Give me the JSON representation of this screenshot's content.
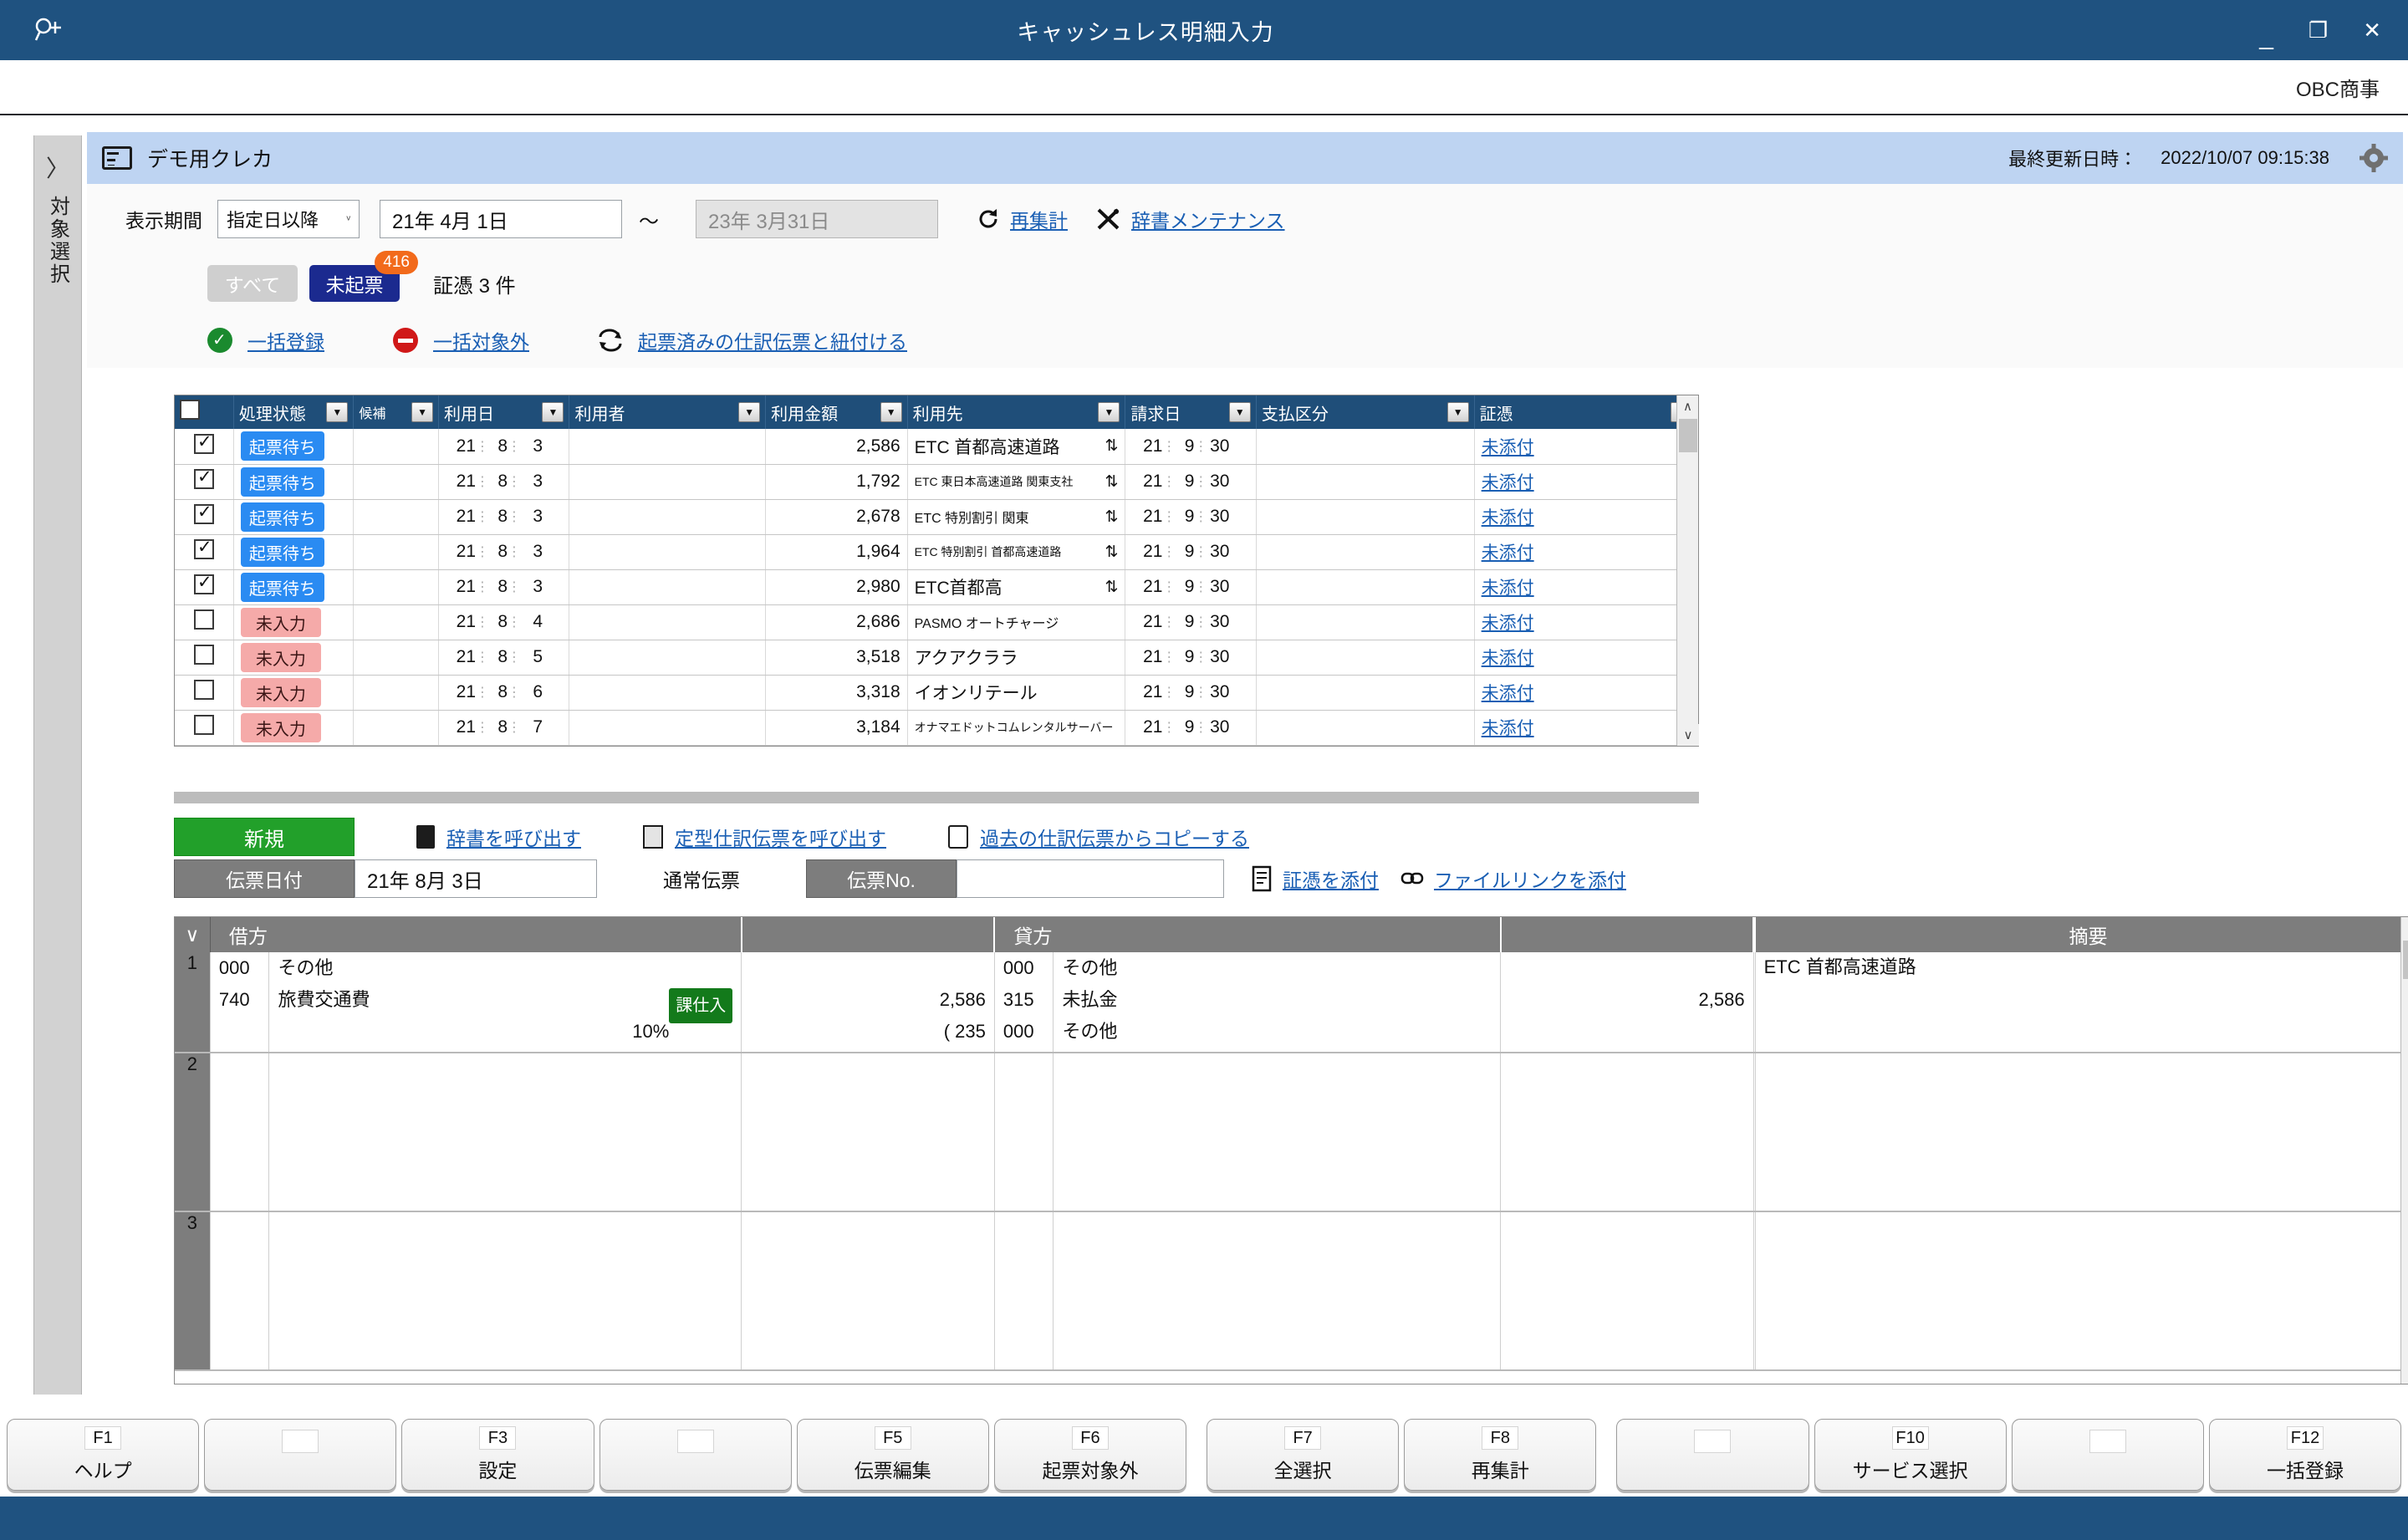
{
  "titlebar": {
    "title": "キャッシュレス明細入力",
    "search_icon": "search-plus-icon",
    "minimize": "_",
    "restore": "❐",
    "close": "✕"
  },
  "company": {
    "name": "OBC商事"
  },
  "leftrail": {
    "chevron": "〉",
    "label": "対象選択"
  },
  "cardhead": {
    "title": "デモ用クレカ",
    "lastupdate_label": "最終更新日時：",
    "lastupdate_value": "2022/10/07 09:15:38"
  },
  "filters": {
    "period_label": "表示期間",
    "period_mode": "指定日以降",
    "date_from": "21年  4月  1日",
    "tilde": "～",
    "date_to": "23年  3月31日",
    "recalc_link": "再集計",
    "dictionary_link": "辞書メンテナンス"
  },
  "tabs": {
    "all_label": "すべて",
    "unposted_label": "未起票",
    "unposted_badge": "416",
    "evidence_count": "証憑 3 件"
  },
  "actions": {
    "bulk_register": "一括登録",
    "bulk_exclude": "一括対象外",
    "link_existing": "起票済みの仕訳伝票と紐付ける"
  },
  "table": {
    "columns": [
      "",
      "処理状態",
      "候補",
      "利用日",
      "利用者",
      "利用金額",
      "利用先",
      "請求日",
      "支払区分",
      "証憑"
    ],
    "rows": [
      {
        "checked": true,
        "selected": true,
        "status": "起票待ち",
        "status_kind": "wait",
        "candidate": "",
        "use_y": "21",
        "use_m": "8",
        "use_d": "3",
        "user": "",
        "amount": "2,586",
        "vendor": "ETC 首都高速道路",
        "vendor_size": "normal",
        "swap": true,
        "bill_y": "21",
        "bill_m": "9",
        "bill_d": "30",
        "pay_type": "",
        "evidence": "未添付"
      },
      {
        "checked": true,
        "selected": false,
        "status": "起票待ち",
        "status_kind": "wait",
        "candidate": "",
        "use_y": "21",
        "use_m": "8",
        "use_d": "3",
        "user": "",
        "amount": "1,792",
        "vendor": "ETC 東日本高速道路 関東支社",
        "vendor_size": "xsmall",
        "swap": true,
        "bill_y": "21",
        "bill_m": "9",
        "bill_d": "30",
        "pay_type": "",
        "evidence": "未添付"
      },
      {
        "checked": true,
        "selected": false,
        "status": "起票待ち",
        "status_kind": "wait",
        "candidate": "",
        "use_y": "21",
        "use_m": "8",
        "use_d": "3",
        "user": "",
        "amount": "2,678",
        "vendor": "ETC 特別割引 関東",
        "vendor_size": "small",
        "swap": true,
        "bill_y": "21",
        "bill_m": "9",
        "bill_d": "30",
        "pay_type": "",
        "evidence": "未添付"
      },
      {
        "checked": true,
        "selected": false,
        "status": "起票待ち",
        "status_kind": "wait",
        "candidate": "",
        "use_y": "21",
        "use_m": "8",
        "use_d": "3",
        "user": "",
        "amount": "1,964",
        "vendor": "ETC 特別割引 首都高速道路",
        "vendor_size": "xsmall",
        "swap": true,
        "bill_y": "21",
        "bill_m": "9",
        "bill_d": "30",
        "pay_type": "",
        "evidence": "未添付"
      },
      {
        "checked": true,
        "selected": false,
        "status": "起票待ち",
        "status_kind": "wait",
        "candidate": "",
        "use_y": "21",
        "use_m": "8",
        "use_d": "3",
        "user": "",
        "amount": "2,980",
        "vendor": "ETC首都高",
        "vendor_size": "normal",
        "swap": true,
        "bill_y": "21",
        "bill_m": "9",
        "bill_d": "30",
        "pay_type": "",
        "evidence": "未添付"
      },
      {
        "checked": false,
        "selected": false,
        "status": "未入力",
        "status_kind": "unentered",
        "candidate": "",
        "use_y": "21",
        "use_m": "8",
        "use_d": "4",
        "user": "",
        "amount": "2,686",
        "vendor": "PASMO オートチャージ",
        "vendor_size": "small",
        "swap": false,
        "bill_y": "21",
        "bill_m": "9",
        "bill_d": "30",
        "pay_type": "",
        "evidence": "未添付"
      },
      {
        "checked": false,
        "selected": false,
        "status": "未入力",
        "status_kind": "unentered",
        "candidate": "",
        "use_y": "21",
        "use_m": "8",
        "use_d": "5",
        "user": "",
        "amount": "3,518",
        "vendor": "アクアクララ",
        "vendor_size": "normal",
        "swap": false,
        "bill_y": "21",
        "bill_m": "9",
        "bill_d": "30",
        "pay_type": "",
        "evidence": "未添付"
      },
      {
        "checked": false,
        "selected": false,
        "status": "未入力",
        "status_kind": "unentered",
        "candidate": "",
        "use_y": "21",
        "use_m": "8",
        "use_d": "6",
        "user": "",
        "amount": "3,318",
        "vendor": "イオンリテール",
        "vendor_size": "normal",
        "swap": false,
        "bill_y": "21",
        "bill_m": "9",
        "bill_d": "30",
        "pay_type": "",
        "evidence": "未添付"
      },
      {
        "checked": false,
        "selected": false,
        "status": "未入力",
        "status_kind": "unentered",
        "candidate": "",
        "use_y": "21",
        "use_m": "8",
        "use_d": "7",
        "user": "",
        "amount": "3,184",
        "vendor": "オナマエドットコムレンタルサーバー",
        "vendor_size": "xsmall",
        "swap": false,
        "bill_y": "21",
        "bill_m": "9",
        "bill_d": "30",
        "pay_type": "",
        "evidence": "未添付"
      }
    ]
  },
  "voucher": {
    "new_button": "新規",
    "dictionary_call": "辞書を呼び出す",
    "template_call": "定型仕訳伝票を呼び出す",
    "copy_past": "過去の仕訳伝票からコピーする",
    "date_label": "伝票日付",
    "date_value": "21年  8月  3日",
    "voucher_type": "通常伝票",
    "no_label": "伝票No.",
    "no_value": "",
    "attach_evidence": "証憑を添付",
    "attach_filelink": "ファイルリンクを添付"
  },
  "journal": {
    "headers": {
      "debit": "借方",
      "credit": "貸方",
      "summary": "摘要"
    },
    "rows": [
      {
        "no": "1",
        "debit": [
          {
            "code": "000",
            "name": "その他",
            "tax": "",
            "rate": "",
            "amount": ""
          },
          {
            "code": "740",
            "name": "旅費交通費",
            "tax": "課仕入",
            "rate": "",
            "amount": "2,586"
          },
          {
            "code": "",
            "name": "",
            "tax": "",
            "rate": "10%",
            "amount": "( 235"
          }
        ],
        "credit": [
          {
            "code": "000",
            "name": "その他",
            "amount": ""
          },
          {
            "code": "315",
            "name": "未払金",
            "amount": "2,586"
          },
          {
            "code": "000",
            "name": "その他",
            "amount": ""
          }
        ],
        "summary": "ETC 首都高速道路"
      },
      {
        "no": "2",
        "debit": [],
        "credit": [],
        "summary": ""
      },
      {
        "no": "3",
        "debit": [],
        "credit": [],
        "summary": ""
      }
    ]
  },
  "fkeys": [
    {
      "key": "F1",
      "label": "ヘルプ"
    },
    {
      "key": "",
      "label": ""
    },
    {
      "key": "F3",
      "label": "設定"
    },
    {
      "key": "",
      "label": ""
    },
    {
      "key": "F5",
      "label": "伝票編集"
    },
    {
      "key": "F6",
      "label": "起票対象外"
    },
    {
      "key": "F7",
      "label": "全選択"
    },
    {
      "key": "F8",
      "label": "再集計"
    },
    {
      "key": "",
      "label": ""
    },
    {
      "key": "F10",
      "label": "サービス選択"
    },
    {
      "key": "",
      "label": ""
    },
    {
      "key": "F12",
      "label": "一括登録"
    }
  ],
  "colors": {
    "title_bar": "#1f5280",
    "card_head": "#bed4f2",
    "grid_head": "#1f4e79",
    "status_wait": "#2a8bf2",
    "status_unentered": "#f5aaa9",
    "badge": "#f26a1b",
    "tab_active": "#1b2a8f",
    "green_new": "#22a02a",
    "tax_tag": "#137a1b",
    "link": "#1a5fb4"
  }
}
